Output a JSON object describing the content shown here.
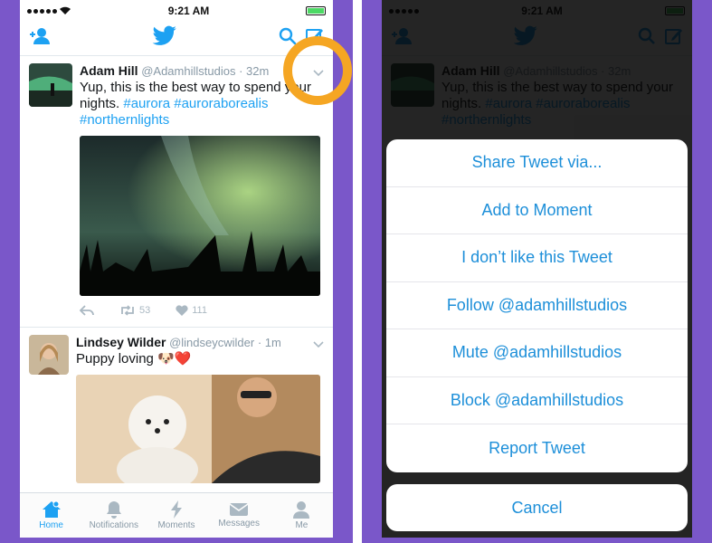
{
  "status": {
    "time": "9:21 AM"
  },
  "tweets": [
    {
      "name": "Adam Hill",
      "handle": "@Adamhillstudios",
      "age": "· 32m",
      "text_lead": "Yup, this is the best way to spend your nights.",
      "hashtags": "#aurora #auroraborealis #northernlights",
      "retweets": "53",
      "likes": "111"
    },
    {
      "name": "Lindsey Wilder",
      "handle": "@lindseycwilder",
      "age": "· 1m",
      "text": "Puppy loving 🐶❤️"
    }
  ],
  "tabs": [
    {
      "label": "Home"
    },
    {
      "label": "Notifications"
    },
    {
      "label": "Moments"
    },
    {
      "label": "Messages"
    },
    {
      "label": "Me"
    }
  ],
  "sheet": {
    "options": [
      "Share Tweet via...",
      "Add to Moment",
      "I don’t like this Tweet",
      "Follow @adamhillstudios",
      "Mute @adamhillstudios",
      "Block @adamhillstudios",
      "Report Tweet"
    ],
    "cancel": "Cancel"
  },
  "colors": {
    "accent": "#1da1f2",
    "frame": "#7a57c9",
    "highlight_ring": "#f5a623"
  }
}
